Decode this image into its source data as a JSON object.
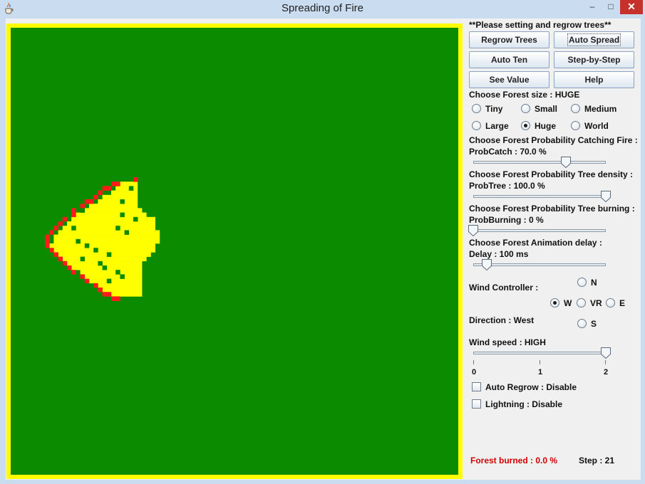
{
  "window": {
    "title": "Spreading of Fire",
    "minimize": "–",
    "maximize": "□",
    "close": "✕",
    "app_icon": "java-cup-icon"
  },
  "colors": {
    "forest": "#0a8b00",
    "burning": "#ffff00",
    "burnt_edge": "#ff1a1a",
    "border": "#ffff00"
  },
  "fire": {
    "yellow_rows": [
      [
        1,
        17,
        20
      ],
      [
        2,
        16,
        20
      ],
      [
        3,
        15,
        20
      ],
      [
        4,
        13,
        20
      ],
      [
        5,
        12,
        20
      ],
      [
        6,
        10,
        20
      ],
      [
        7,
        9,
        21
      ],
      [
        8,
        7,
        22
      ],
      [
        9,
        6,
        24
      ],
      [
        10,
        5,
        24
      ],
      [
        11,
        4,
        24
      ],
      [
        12,
        3,
        25
      ],
      [
        13,
        2,
        25
      ],
      [
        14,
        2,
        25
      ],
      [
        15,
        1,
        24
      ],
      [
        16,
        2,
        24
      ],
      [
        17,
        3,
        23
      ],
      [
        18,
        4,
        22
      ],
      [
        19,
        5,
        21
      ],
      [
        20,
        6,
        21
      ],
      [
        21,
        8,
        21
      ],
      [
        22,
        9,
        21
      ],
      [
        23,
        10,
        21
      ],
      [
        24,
        12,
        21
      ],
      [
        25,
        13,
        21
      ],
      [
        26,
        15,
        21
      ]
    ],
    "red_cells": [
      [
        0,
        20
      ],
      [
        1,
        15
      ],
      [
        1,
        16
      ],
      [
        2,
        13
      ],
      [
        2,
        14
      ],
      [
        3,
        12
      ],
      [
        4,
        11
      ],
      [
        5,
        9
      ],
      [
        5,
        10
      ],
      [
        6,
        8
      ],
      [
        7,
        6
      ],
      [
        8,
        6
      ],
      [
        9,
        4
      ],
      [
        10,
        3
      ],
      [
        11,
        2
      ],
      [
        12,
        1
      ],
      [
        13,
        0
      ],
      [
        14,
        0
      ],
      [
        15,
        0
      ],
      [
        16,
        1
      ],
      [
        17,
        2
      ],
      [
        18,
        3
      ],
      [
        19,
        4
      ],
      [
        20,
        5
      ],
      [
        21,
        6
      ],
      [
        22,
        8
      ],
      [
        23,
        9
      ],
      [
        24,
        11
      ],
      [
        25,
        12
      ],
      [
        26,
        13
      ],
      [
        26,
        14
      ],
      [
        27,
        15
      ],
      [
        27,
        16
      ]
    ],
    "green_cells": [
      [
        2,
        19
      ],
      [
        5,
        17
      ],
      [
        7,
        8
      ],
      [
        8,
        17
      ],
      [
        9,
        20
      ],
      [
        11,
        16
      ],
      [
        12,
        18
      ],
      [
        14,
        7
      ],
      [
        16,
        11
      ],
      [
        17,
        14
      ],
      [
        18,
        8
      ],
      [
        19,
        12
      ],
      [
        20,
        13
      ],
      [
        21,
        16
      ],
      [
        22,
        17
      ],
      [
        23,
        14
      ],
      [
        11,
        6
      ],
      [
        15,
        9
      ]
    ]
  },
  "panel": {
    "hint": "**Please setting and regrow trees**",
    "buttons": {
      "regrow": "Regrow Trees",
      "auto_spread": "Auto Spread",
      "auto_ten": "Auto Ten",
      "step_by_step": "Step-by-Step",
      "see_value": "See Value",
      "help": "Help"
    },
    "forest_size": {
      "label": "Choose Forest size : HUGE",
      "options": [
        "Tiny",
        "Small",
        "Medium",
        "Large",
        "Huge",
        "World"
      ],
      "selected": "Huge"
    },
    "prob_catch": {
      "label": "Choose Forest Probability Catching Fire :",
      "value_label": "ProbCatch : 70.0 %",
      "fraction": 0.7
    },
    "prob_tree": {
      "label": "Choose Forest Probability Tree density :",
      "value_label": "ProbTree : 100.0 %",
      "fraction": 1.0
    },
    "prob_burning": {
      "label": "Choose Forest Probability Tree burning :",
      "value_label": "ProbBurning : 0 %",
      "fraction": 0.0
    },
    "delay": {
      "label": "Choose Forest Animation delay :",
      "value_label": "Delay : 100 ms",
      "fraction": 0.1
    },
    "wind": {
      "controller_label": "Wind Controller :",
      "n": "N",
      "w": "W",
      "vr": "VR",
      "e": "E",
      "s": "S",
      "selected": "W",
      "direction_label": "Direction : West",
      "speed_label": "Wind speed : HIGH",
      "speed_value": 2,
      "tick_labels": [
        "0",
        "1",
        "2"
      ]
    },
    "auto_regrow": "Auto Regrow : Disable",
    "lightning": "Lightning : Disable",
    "burned": "Forest burned : 0.0 %",
    "step": "Step : 21"
  }
}
